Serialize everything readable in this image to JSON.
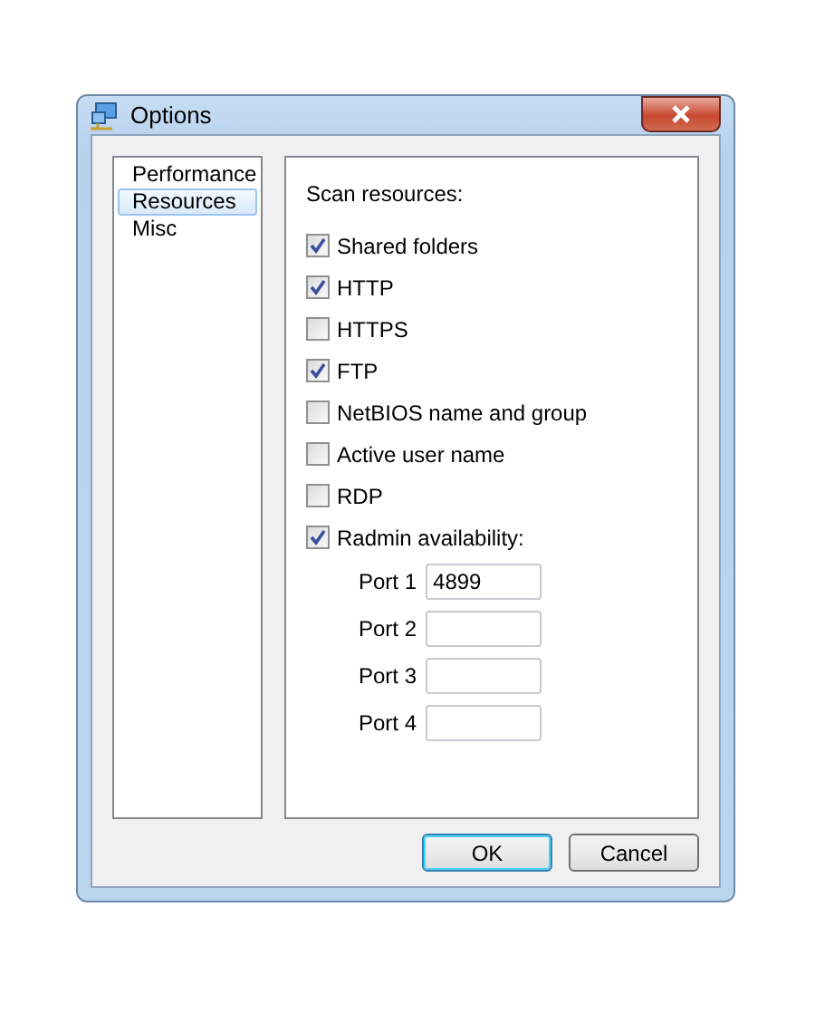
{
  "window": {
    "title": "Options"
  },
  "sidebar": {
    "items": [
      {
        "label": "Performance",
        "selected": false
      },
      {
        "label": "Resources",
        "selected": true
      },
      {
        "label": "Misc",
        "selected": false
      }
    ]
  },
  "panel": {
    "heading": "Scan resources:",
    "options": [
      {
        "label": "Shared folders",
        "checked": true
      },
      {
        "label": "HTTP",
        "checked": true
      },
      {
        "label": "HTTPS",
        "checked": false
      },
      {
        "label": "FTP",
        "checked": true
      },
      {
        "label": "NetBIOS name and group",
        "checked": false
      },
      {
        "label": "Active user name",
        "checked": false
      },
      {
        "label": "RDP",
        "checked": false
      },
      {
        "label": "Radmin availability:",
        "checked": true
      }
    ],
    "ports": [
      {
        "label": "Port 1",
        "value": "4899"
      },
      {
        "label": "Port 2"
      },
      {
        "label": "Port 3"
      },
      {
        "label": "Port 4"
      }
    ]
  },
  "buttons": [
    {
      "label": "OK",
      "default": true
    },
    {
      "label": "Cancel",
      "default": false
    }
  ]
}
